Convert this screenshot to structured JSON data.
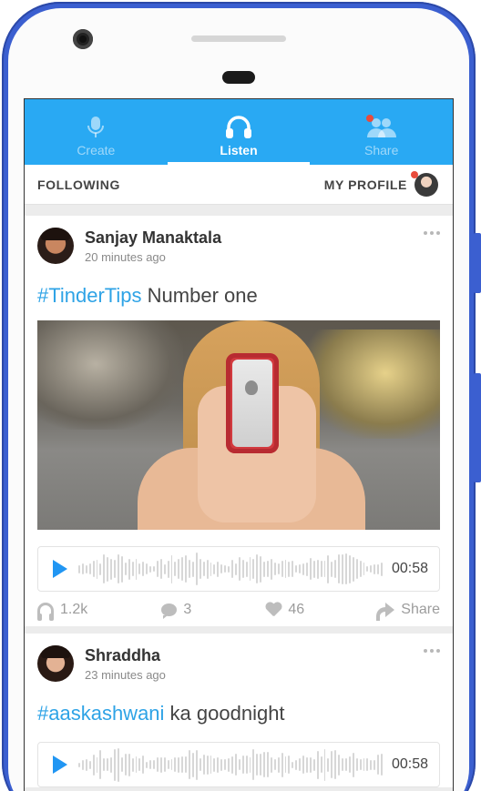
{
  "tabs": [
    {
      "label": "Create",
      "icon": "microphone-icon"
    },
    {
      "label": "Listen",
      "icon": "headphones-icon"
    },
    {
      "label": "Share",
      "icon": "people-icon"
    }
  ],
  "active_tab": "Listen",
  "subnav": {
    "following": "FOLLOWING",
    "my_profile": "MY PROFILE"
  },
  "posts": [
    {
      "author": "Sanjay Manaktala",
      "time": "20 minutes ago",
      "hashtag": "#TinderTips",
      "text": " Number one",
      "duration": "00:58",
      "listens": "1.2k",
      "comments": "3",
      "likes": "46",
      "share": "Share"
    },
    {
      "author": "Shraddha",
      "time": "23 minutes ago",
      "hashtag": "#aaskashwani",
      "text": " ka goodnight",
      "duration": "00:58"
    }
  ],
  "colors": {
    "primary": "#29a9f3",
    "accent": "#2196f3",
    "hashtag": "#2ea3e6",
    "notification": "#e84b3c",
    "frame": "#3b5fd0"
  }
}
